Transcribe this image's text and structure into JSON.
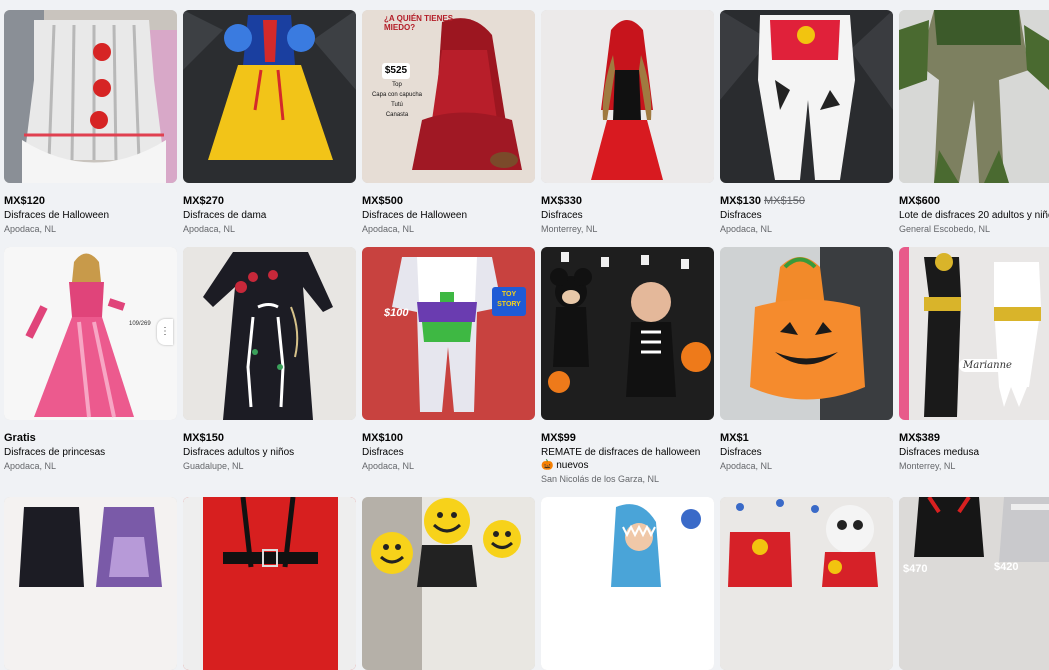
{
  "listings": [
    {
      "price": "MX$120",
      "title": "Disfraces de Halloween",
      "location": "Apodaca, NL"
    },
    {
      "price": "MX$270",
      "title": "Disfraces de dama",
      "location": "Apodaca, NL"
    },
    {
      "price": "MX$500",
      "title": "Disfraces de Halloween",
      "location": "Apodaca, NL",
      "overlay": {
        "question": "¿A QUIÉN TIENES MIEDO?",
        "amount": "$525",
        "lines": [
          "Top",
          "Capa con capucha",
          "Tutú",
          "Canasta"
        ]
      }
    },
    {
      "price": "MX$330",
      "title": "Disfraces",
      "location": "Monterrey, NL"
    },
    {
      "price": "MX$130",
      "original_price": "MX$150",
      "title": "Disfraces",
      "location": "Apodaca, NL"
    },
    {
      "price": "MX$600",
      "title": "Lote de disfraces 20 adultos y niños",
      "location": "General Escobedo, NL"
    },
    {
      "price": "Gratis",
      "title": "Disfraces de princesas",
      "location": "Apodaca, NL",
      "overlay": {
        "tag": "109/269"
      }
    },
    {
      "price": "MX$150",
      "title": "Disfraces adultos y niños",
      "location": "Guadalupe, NL"
    },
    {
      "price": "MX$100",
      "title": "Disfraces",
      "location": "Apodaca, NL",
      "overlay": {
        "tag": "$100",
        "box": "TOY STORY"
      }
    },
    {
      "price": "MX$99",
      "title": "REMATE de disfraces de halloween 🎃 nuevos",
      "location": "San Nicolás de los Garza, NL"
    },
    {
      "price": "MX$1",
      "title": "Disfraces",
      "location": "Apodaca, NL"
    },
    {
      "price": "MX$389",
      "title": "Disfraces medusa",
      "location": "Monterrey, NL",
      "overlay": {
        "tag": "Marianne"
      }
    },
    {
      "image": "dark-dress-photo"
    },
    {
      "image": "red-dress-photo"
    },
    {
      "image": "smiley-kids-photo"
    },
    {
      "image": "shark-baby-photo"
    },
    {
      "image": "paw-patrol-photo"
    },
    {
      "image": "dresses-prices-photo",
      "overlay": {
        "tags": [
          "$470",
          "$420"
        ]
      }
    }
  ]
}
